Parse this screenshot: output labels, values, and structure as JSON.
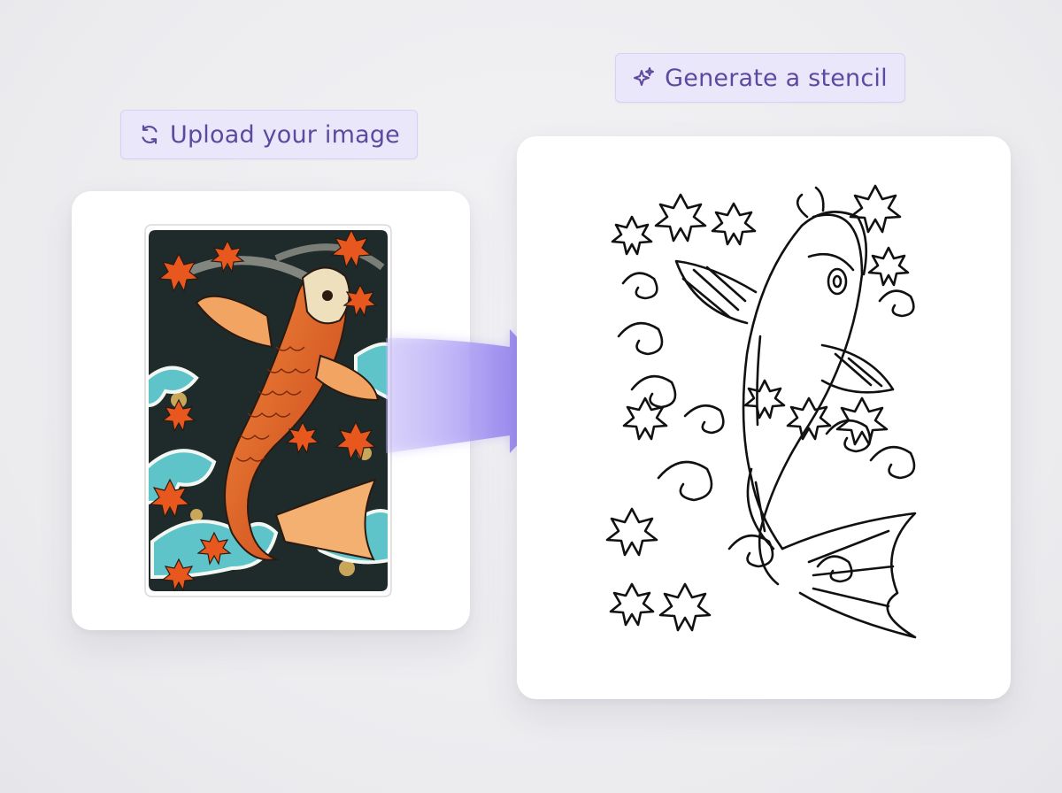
{
  "steps": {
    "upload": {
      "label": "Upload your image",
      "icon": "refresh-icon"
    },
    "generate": {
      "label": "Generate a stencil",
      "icon": "sparkle-icon"
    }
  },
  "images": {
    "source": "colored-koi-tattoo-image",
    "result": "line-art-koi-stencil"
  },
  "colors": {
    "accent": "#8b78f0",
    "pill_bg": "#ebe7fb",
    "pill_text": "#5d4a9e",
    "koi_orange": "#e8571e",
    "wave_teal": "#5ec4c9",
    "background_dark": "#1f2a2b"
  }
}
